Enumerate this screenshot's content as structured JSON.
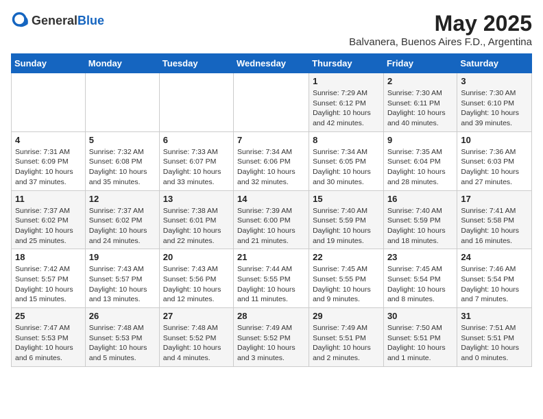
{
  "header": {
    "logo_general": "General",
    "logo_blue": "Blue",
    "month_title": "May 2025",
    "location": "Balvanera, Buenos Aires F.D., Argentina"
  },
  "weekdays": [
    "Sunday",
    "Monday",
    "Tuesday",
    "Wednesday",
    "Thursday",
    "Friday",
    "Saturday"
  ],
  "weeks": [
    [
      {
        "day": "",
        "info": ""
      },
      {
        "day": "",
        "info": ""
      },
      {
        "day": "",
        "info": ""
      },
      {
        "day": "",
        "info": ""
      },
      {
        "day": "1",
        "info": "Sunrise: 7:29 AM\nSunset: 6:12 PM\nDaylight: 10 hours\nand 42 minutes."
      },
      {
        "day": "2",
        "info": "Sunrise: 7:30 AM\nSunset: 6:11 PM\nDaylight: 10 hours\nand 40 minutes."
      },
      {
        "day": "3",
        "info": "Sunrise: 7:30 AM\nSunset: 6:10 PM\nDaylight: 10 hours\nand 39 minutes."
      }
    ],
    [
      {
        "day": "4",
        "info": "Sunrise: 7:31 AM\nSunset: 6:09 PM\nDaylight: 10 hours\nand 37 minutes."
      },
      {
        "day": "5",
        "info": "Sunrise: 7:32 AM\nSunset: 6:08 PM\nDaylight: 10 hours\nand 35 minutes."
      },
      {
        "day": "6",
        "info": "Sunrise: 7:33 AM\nSunset: 6:07 PM\nDaylight: 10 hours\nand 33 minutes."
      },
      {
        "day": "7",
        "info": "Sunrise: 7:34 AM\nSunset: 6:06 PM\nDaylight: 10 hours\nand 32 minutes."
      },
      {
        "day": "8",
        "info": "Sunrise: 7:34 AM\nSunset: 6:05 PM\nDaylight: 10 hours\nand 30 minutes."
      },
      {
        "day": "9",
        "info": "Sunrise: 7:35 AM\nSunset: 6:04 PM\nDaylight: 10 hours\nand 28 minutes."
      },
      {
        "day": "10",
        "info": "Sunrise: 7:36 AM\nSunset: 6:03 PM\nDaylight: 10 hours\nand 27 minutes."
      }
    ],
    [
      {
        "day": "11",
        "info": "Sunrise: 7:37 AM\nSunset: 6:02 PM\nDaylight: 10 hours\nand 25 minutes."
      },
      {
        "day": "12",
        "info": "Sunrise: 7:37 AM\nSunset: 6:02 PM\nDaylight: 10 hours\nand 24 minutes."
      },
      {
        "day": "13",
        "info": "Sunrise: 7:38 AM\nSunset: 6:01 PM\nDaylight: 10 hours\nand 22 minutes."
      },
      {
        "day": "14",
        "info": "Sunrise: 7:39 AM\nSunset: 6:00 PM\nDaylight: 10 hours\nand 21 minutes."
      },
      {
        "day": "15",
        "info": "Sunrise: 7:40 AM\nSunset: 5:59 PM\nDaylight: 10 hours\nand 19 minutes."
      },
      {
        "day": "16",
        "info": "Sunrise: 7:40 AM\nSunset: 5:59 PM\nDaylight: 10 hours\nand 18 minutes."
      },
      {
        "day": "17",
        "info": "Sunrise: 7:41 AM\nSunset: 5:58 PM\nDaylight: 10 hours\nand 16 minutes."
      }
    ],
    [
      {
        "day": "18",
        "info": "Sunrise: 7:42 AM\nSunset: 5:57 PM\nDaylight: 10 hours\nand 15 minutes."
      },
      {
        "day": "19",
        "info": "Sunrise: 7:43 AM\nSunset: 5:57 PM\nDaylight: 10 hours\nand 13 minutes."
      },
      {
        "day": "20",
        "info": "Sunrise: 7:43 AM\nSunset: 5:56 PM\nDaylight: 10 hours\nand 12 minutes."
      },
      {
        "day": "21",
        "info": "Sunrise: 7:44 AM\nSunset: 5:55 PM\nDaylight: 10 hours\nand 11 minutes."
      },
      {
        "day": "22",
        "info": "Sunrise: 7:45 AM\nSunset: 5:55 PM\nDaylight: 10 hours\nand 9 minutes."
      },
      {
        "day": "23",
        "info": "Sunrise: 7:45 AM\nSunset: 5:54 PM\nDaylight: 10 hours\nand 8 minutes."
      },
      {
        "day": "24",
        "info": "Sunrise: 7:46 AM\nSunset: 5:54 PM\nDaylight: 10 hours\nand 7 minutes."
      }
    ],
    [
      {
        "day": "25",
        "info": "Sunrise: 7:47 AM\nSunset: 5:53 PM\nDaylight: 10 hours\nand 6 minutes."
      },
      {
        "day": "26",
        "info": "Sunrise: 7:48 AM\nSunset: 5:53 PM\nDaylight: 10 hours\nand 5 minutes."
      },
      {
        "day": "27",
        "info": "Sunrise: 7:48 AM\nSunset: 5:52 PM\nDaylight: 10 hours\nand 4 minutes."
      },
      {
        "day": "28",
        "info": "Sunrise: 7:49 AM\nSunset: 5:52 PM\nDaylight: 10 hours\nand 3 minutes."
      },
      {
        "day": "29",
        "info": "Sunrise: 7:49 AM\nSunset: 5:51 PM\nDaylight: 10 hours\nand 2 minutes."
      },
      {
        "day": "30",
        "info": "Sunrise: 7:50 AM\nSunset: 5:51 PM\nDaylight: 10 hours\nand 1 minute."
      },
      {
        "day": "31",
        "info": "Sunrise: 7:51 AM\nSunset: 5:51 PM\nDaylight: 10 hours\nand 0 minutes."
      }
    ]
  ]
}
